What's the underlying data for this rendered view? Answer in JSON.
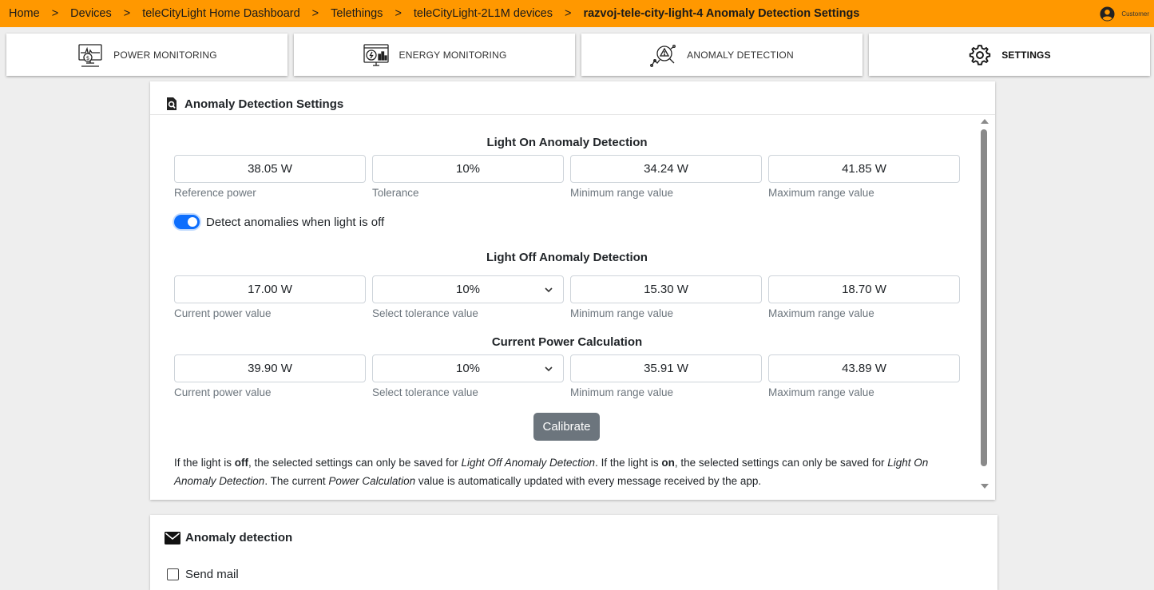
{
  "breadcrumb": {
    "items": [
      "Home",
      "Devices",
      "teleCityLight Home Dashboard",
      "Telethings",
      "teleCityLight-2L1M devices",
      "razvoj-tele-city-light-4 Anomaly Detection Settings"
    ],
    "separator": ">"
  },
  "user": {
    "label": "Customer",
    "icon": "user-circle-icon"
  },
  "tabs": [
    {
      "label": "POWER MONITORING",
      "icon": "power-monitor-icon"
    },
    {
      "label": "ENERGY MONITORING",
      "icon": "energy-monitor-icon"
    },
    {
      "label": "ANOMALY DETECTION",
      "icon": "anomaly-detection-icon"
    },
    {
      "label": "SETTINGS",
      "icon": "gear-icon",
      "active": true
    }
  ],
  "settings_card": {
    "title": "Anomaly Detection Settings",
    "light_on": {
      "title": "Light On Anomaly Detection",
      "reference_power": {
        "value": "38.05 W",
        "hint": "Reference power"
      },
      "tolerance": {
        "value": "10%",
        "hint": "Tolerance"
      },
      "min": {
        "value": "34.24 W",
        "hint": "Minimum range value"
      },
      "max": {
        "value": "41.85 W",
        "hint": "Maximum range value"
      }
    },
    "toggle": {
      "label": "Detect anomalies when light is off",
      "checked": true
    },
    "light_off": {
      "title": "Light Off Anomaly Detection",
      "current_power": {
        "value": "17.00 W",
        "hint": "Current power value"
      },
      "tolerance": {
        "value": "10%",
        "hint": "Select tolerance value"
      },
      "min": {
        "value": "15.30 W",
        "hint": "Minimum range value"
      },
      "max": {
        "value": "18.70 W",
        "hint": "Maximum range value"
      }
    },
    "current_calc": {
      "title": "Current Power Calculation",
      "current_power": {
        "value": "39.90 W",
        "hint": "Current power value"
      },
      "tolerance": {
        "value": "10%",
        "hint": "Select tolerance value"
      },
      "min": {
        "value": "35.91 W",
        "hint": "Minimum range value"
      },
      "max": {
        "value": "43.89 W",
        "hint": "Maximum range value"
      }
    },
    "calibrate_label": "Calibrate",
    "note": {
      "t1": "If the light is ",
      "b1": "off",
      "t2": ", the selected settings can only be saved for ",
      "i1": "Light Off Anomaly Detection",
      "t3": ". If the light is ",
      "b2": "on",
      "t4": ", the selected settings can only be saved for ",
      "i2": "Light On Anomaly Detection",
      "t5": ". The current ",
      "i3": "Power Calculation",
      "t6": " value is automatically updated with every message received by the app."
    }
  },
  "mail_card": {
    "title": "Anomaly detection",
    "checkbox_label": "Send mail",
    "checked": false
  },
  "colors": {
    "topbar": "#ff9800",
    "primary": "#0d6efd",
    "button_secondary": "#6c757d",
    "background": "#eeeeee"
  }
}
